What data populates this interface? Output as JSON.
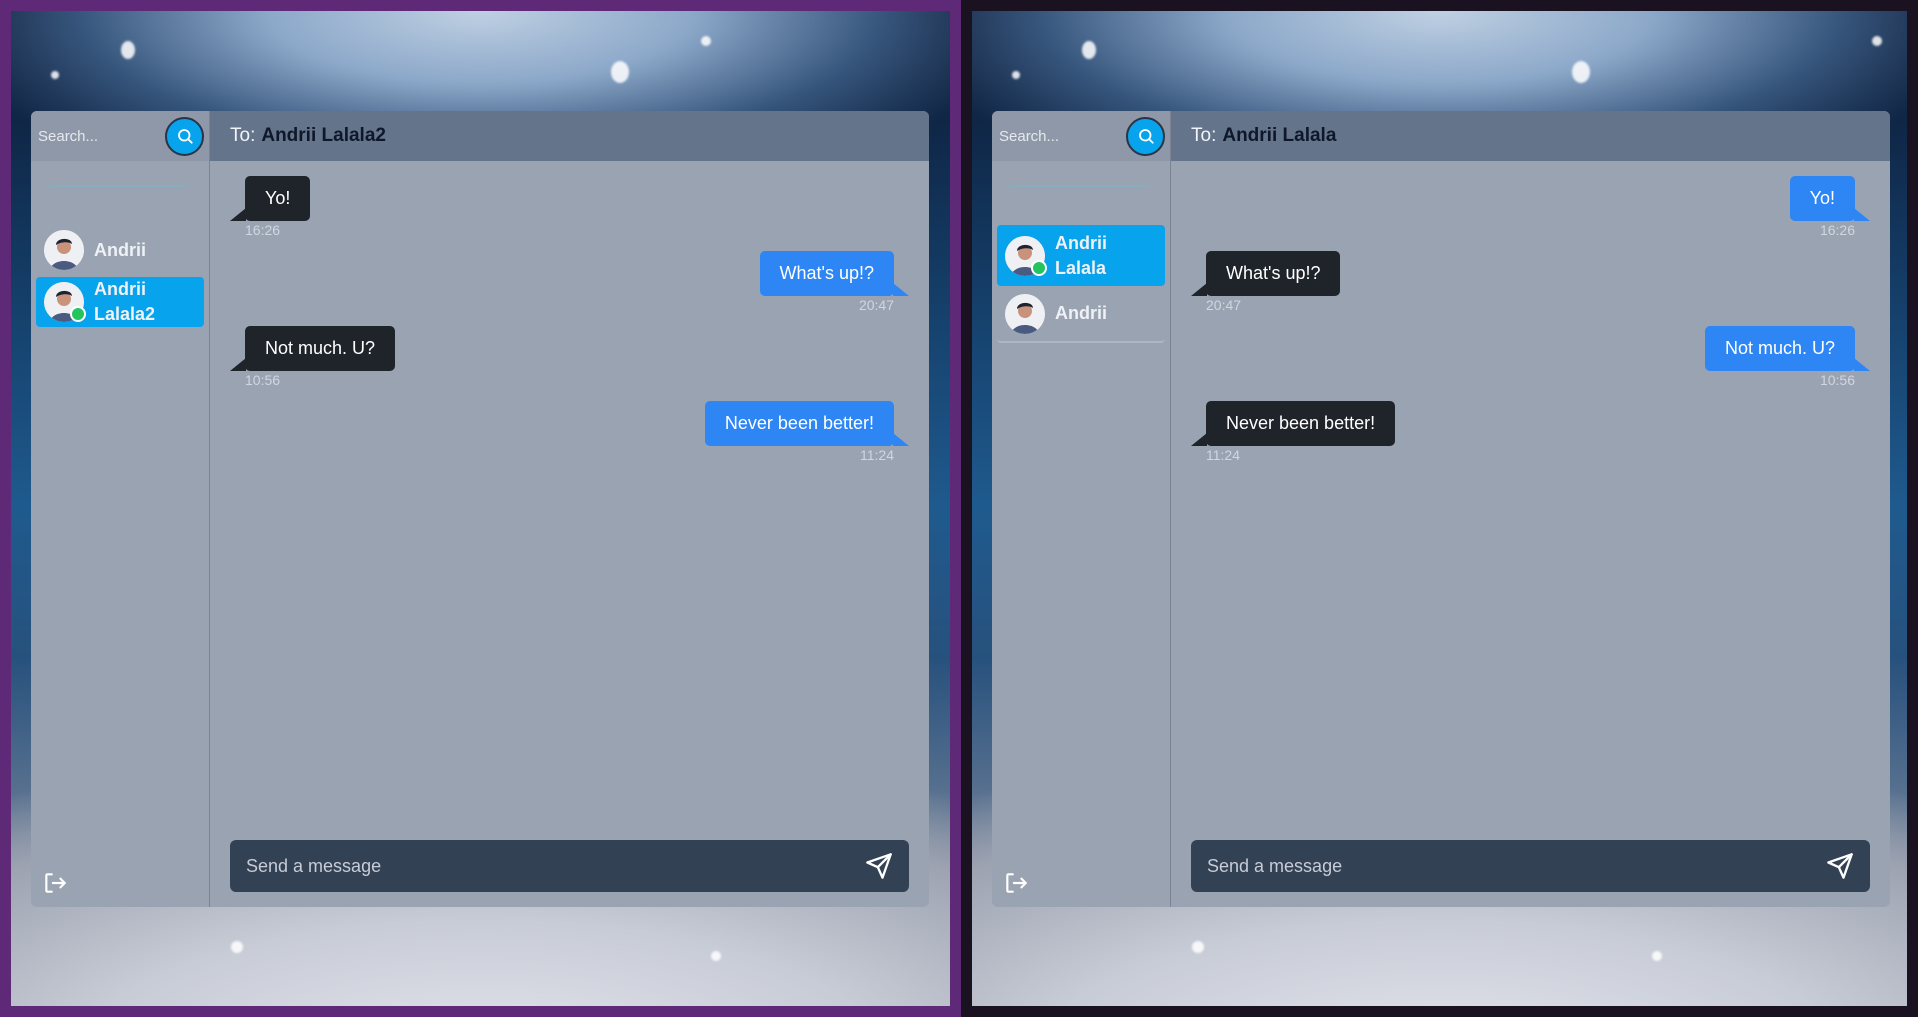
{
  "windows": [
    {
      "search": {
        "placeholder": "Search..."
      },
      "contacts": [
        {
          "name": "Andrii",
          "active": false,
          "online": false
        },
        {
          "name": "Andrii Lalala2",
          "active": true,
          "online": true
        }
      ],
      "chat": {
        "to_prefix": "To:",
        "to_name": "Andrii Lalala2",
        "messages": [
          {
            "text": "Yo!",
            "time": "16:26",
            "direction": "in"
          },
          {
            "text": "What's up!?",
            "time": "20:47",
            "direction": "out"
          },
          {
            "text": "Not much. U?",
            "time": "10:56",
            "direction": "in"
          },
          {
            "text": "Never been better!",
            "time": "11:24",
            "direction": "out"
          }
        ],
        "composer_placeholder": "Send a message"
      }
    },
    {
      "search": {
        "placeholder": "Search..."
      },
      "contacts": [
        {
          "name": "Andrii Lalala",
          "active": true,
          "online": true
        },
        {
          "name": "Andrii",
          "active": false,
          "online": false
        }
      ],
      "chat": {
        "to_prefix": "To:",
        "to_name": "Andrii Lalala",
        "messages": [
          {
            "text": "Yo!",
            "time": "16:26",
            "direction": "out"
          },
          {
            "text": "What's up!?",
            "time": "20:47",
            "direction": "in"
          },
          {
            "text": "Not much. U?",
            "time": "10:56",
            "direction": "out"
          },
          {
            "text": "Never been better!",
            "time": "11:24",
            "direction": "in"
          }
        ],
        "composer_placeholder": "Send a message"
      }
    }
  ],
  "icons": {
    "search": "search-icon",
    "send": "send-icon",
    "logout": "logout-icon",
    "avatar": "user-avatar"
  },
  "colors": {
    "accent": "#07a3ec",
    "outgoing_bubble": "#2e86f5",
    "incoming_bubble": "#1f232a",
    "online": "#22c55e"
  }
}
